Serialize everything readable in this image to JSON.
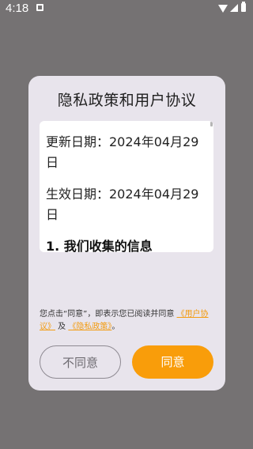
{
  "status_bar": {
    "time": "4:18",
    "notification_icon": "notification-icon",
    "wifi_icon": "wifi-icon",
    "signal_icon": "signal-icon",
    "battery_icon": "battery-icon"
  },
  "dialog": {
    "title": "隐私政策和用户协议",
    "content": {
      "updated_date": "更新日期：2024年04月29日",
      "effective_date": "生效日期：2024年04月29日",
      "section_1_heading": "1. 我们收集的信息"
    },
    "notice": {
      "prefix": "您点击“同意”，即表示您已阅读并同意 ",
      "user_agreement_link": "《用户协议》",
      "and": " 及 ",
      "privacy_policy_link": "《隐私政策》",
      "suffix": "。"
    },
    "buttons": {
      "decline": "不同意",
      "agree": "同意"
    }
  },
  "colors": {
    "overlay": "#757273",
    "dialog_bg": "#e8e4ec",
    "accent": "#f99d0a",
    "link": "#f39c12"
  }
}
